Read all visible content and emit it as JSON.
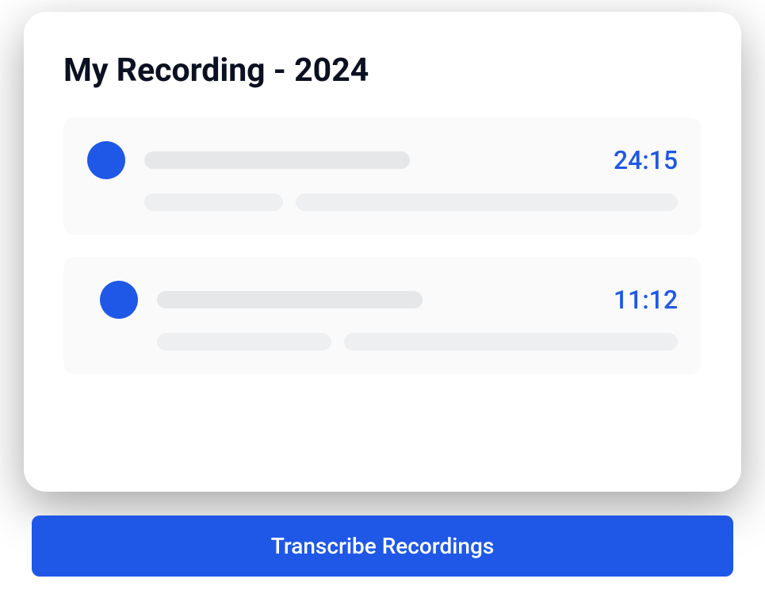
{
  "page_title": "My Recording - 2024",
  "recordings": [
    {
      "timestamp": "24:15"
    },
    {
      "timestamp": "11:12"
    }
  ],
  "transcribe_button_label": "Transcribe Recordings",
  "colors": {
    "accent": "#1f58e7",
    "skeleton_dark": "#e6e7e9",
    "skeleton_light": "#eeeff1",
    "card_bg": "#fafafa"
  }
}
